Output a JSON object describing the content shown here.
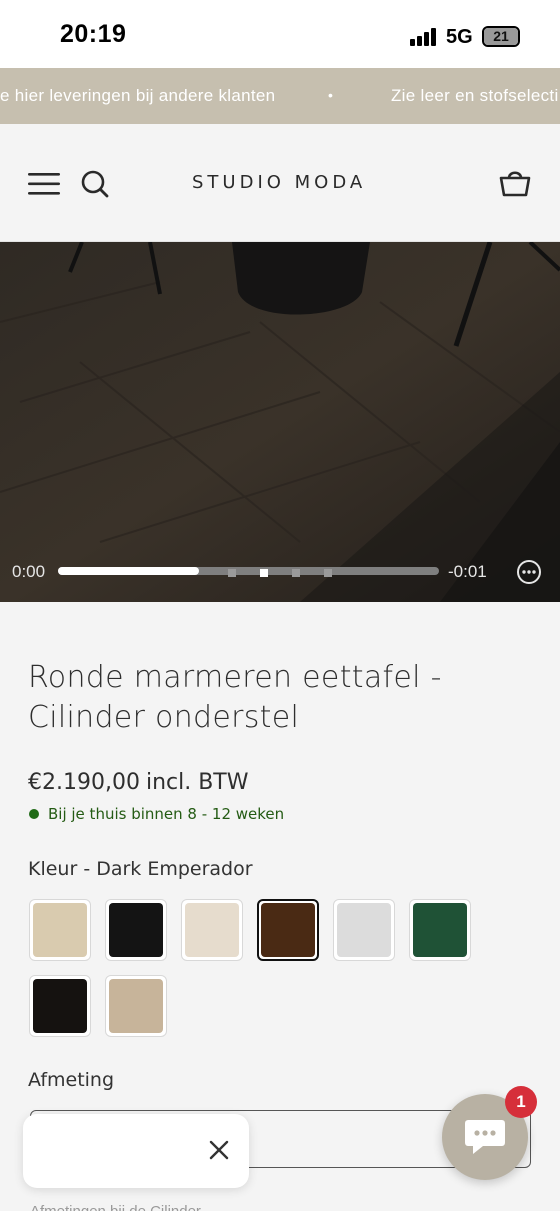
{
  "status_bar": {
    "time": "20:19",
    "network": "5G",
    "battery": "21"
  },
  "announcement": {
    "messages": [
      "Zie hier leveringen bij andere klanten",
      "Zie leer en stofselectie"
    ],
    "visible_left": "e hier leveringen bij andere klanten",
    "visible_right": "Zie leer en stofselecti",
    "separator": "•"
  },
  "header": {
    "brand": "STUDIO MODA",
    "icons": [
      "menu-icon",
      "search-icon",
      "basket-icon"
    ]
  },
  "video": {
    "current_time": "0:00",
    "remaining_time": "-0:01",
    "progress_fraction": 0.37,
    "pages": 4,
    "active_page": 2
  },
  "product": {
    "title": "Ronde marmeren eettafel - Cilinder onderstel",
    "price": "€2.190,00",
    "price_suffix": "incl. BTW",
    "delivery": "Bij je thuis binnen 8 - 12 weken",
    "colour_label": "Kleur - Dark Emperador",
    "colours": [
      {
        "name": "Crema Marfil",
        "color": "#d9cbaf",
        "selected": false
      },
      {
        "name": "Nero Marquina",
        "color": "#141414",
        "selected": false
      },
      {
        "name": "Botticino",
        "color": "#e6dccd",
        "selected": false
      },
      {
        "name": "Dark Emperador",
        "color": "#4a2a14",
        "selected": true
      },
      {
        "name": "Arabescato",
        "color": "#dcdcdc",
        "selected": false
      },
      {
        "name": "Verde Guatemala",
        "color": "#1f5236",
        "selected": false
      },
      {
        "name": "Portoro",
        "color": "#151210",
        "selected": false
      },
      {
        "name": "Emperador Light",
        "color": "#c7b49a",
        "selected": false
      }
    ],
    "size_label": "Afmeting",
    "size_value": "",
    "faded_text": "Afmetingen bij de Cilinder..."
  },
  "popup": {
    "close_icon": "close-icon"
  },
  "chat": {
    "badge": "1",
    "icon": "chat-icon"
  },
  "colors": {
    "accent": "#c6bfaf",
    "stock_green": "#1f6a16",
    "badge_red": "#d62f3a"
  }
}
